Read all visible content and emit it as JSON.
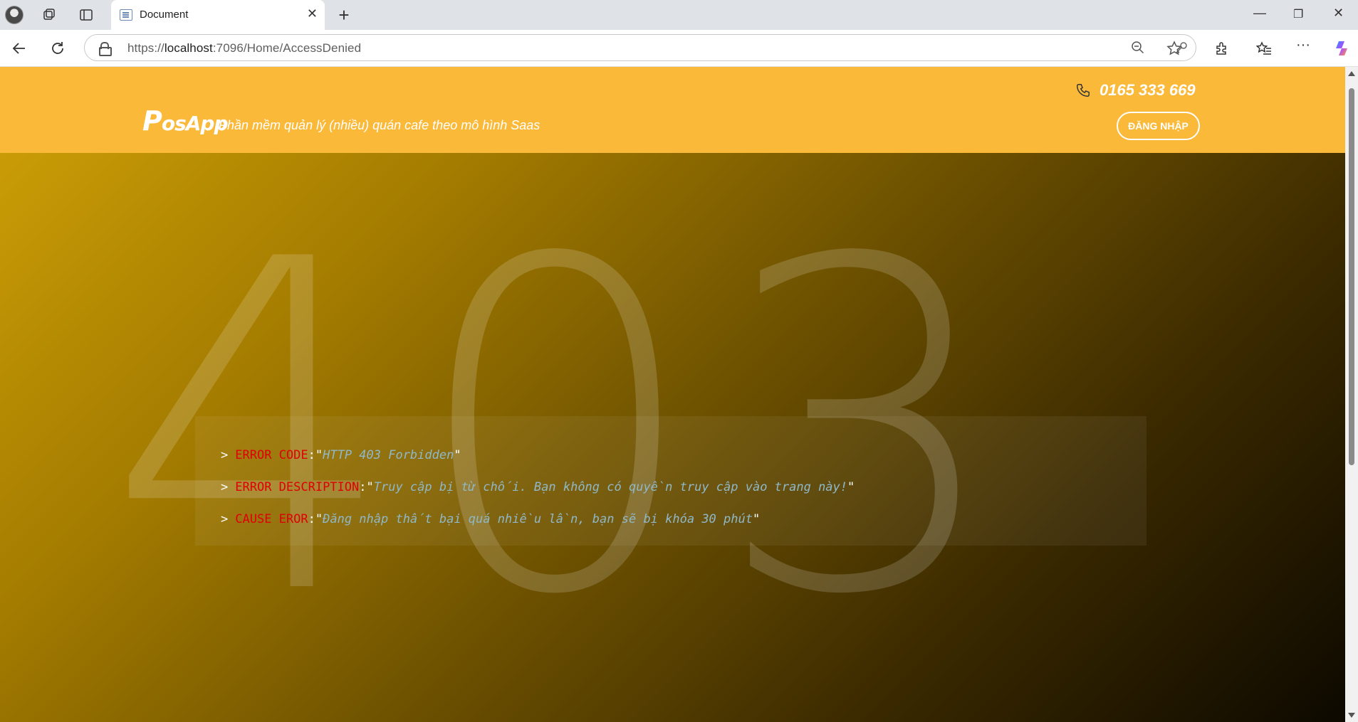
{
  "browser": {
    "tab_title": "Document",
    "url_prefix": "https://",
    "url_host": "localhost",
    "url_path": ":7096/Home/AccessDenied",
    "icons": [
      "profile-icon",
      "collections-icon",
      "tab-actions-icon",
      "page-icon",
      "close-tab-icon",
      "new-tab-icon",
      "minimize-icon",
      "restore-icon",
      "close-window-icon",
      "back-icon",
      "refresh-icon",
      "lock-icon",
      "key-icon",
      "zoom-out-icon",
      "favorite-star-icon",
      "extensions-icon",
      "favorites-icon",
      "more-icon",
      "copilot-icon"
    ]
  },
  "header": {
    "logo": "PosApp",
    "logo_first": "P",
    "logo_rest": "osApp",
    "tagline": "Phần mềm quản lý (nhiều) quán cafe theo mô hình Saas",
    "phone": "0165 333 669",
    "login_label": "ĐĂNG NHẬP"
  },
  "hero": {
    "code_background": "403",
    "lines": [
      {
        "prompt": ">",
        "key": "ERROR CODE",
        "value": "HTTP 403 Forbidden"
      },
      {
        "prompt": ">",
        "key": "ERROR DESCRIPTION",
        "value": "Truy cập bị từ chối. Bạn không có quyền truy cập vào trang này!"
      },
      {
        "prompt": ">",
        "key": "CAUSE EROR",
        "value": "Đăng nhập thất bại quá nhiều lần, bạn sẽ bị khóa 30 phút"
      }
    ]
  },
  "colors": {
    "header_bg": "#fbb93a",
    "key_red": "#e00000",
    "value_blue": "#8fb8c8"
  }
}
